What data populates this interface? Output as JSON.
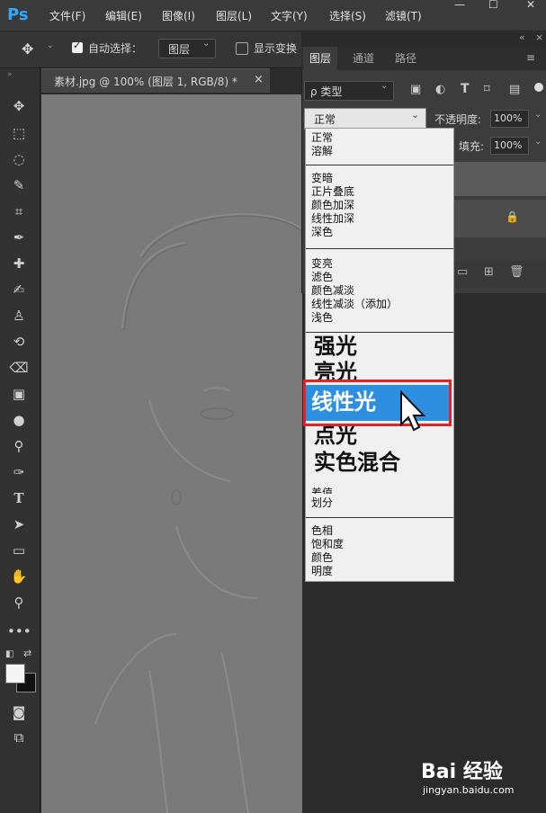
{
  "app": {
    "logo": "Ps",
    "menu": [
      "文件(F)",
      "编辑(E)",
      "图像(I)",
      "图层(L)",
      "文字(Y)",
      "选择(S)",
      "滤镜(T)"
    ]
  },
  "options_bar": {
    "auto_select_label": "自动选择：",
    "auto_select_target": "图层",
    "show_transform_label": "显示变换"
  },
  "document": {
    "tab_title": "素材.jpg @ 100% (图层 1, RGB/8) *",
    "close_glyph": "×"
  },
  "layers_panel": {
    "tabs": [
      "图层",
      "通道",
      "路径"
    ],
    "filter_kind": "ρ 类型",
    "blend_mode": "正常",
    "opacity_label": "不透明度:",
    "opacity_value": "100%",
    "fill_label": "填充:",
    "fill_value": "100%"
  },
  "blend_dropdown": {
    "group1": [
      "正常",
      "溶解"
    ],
    "group2": [
      "变暗",
      "正片叠底",
      "颜色加深",
      "线性加深",
      "深色"
    ],
    "group3": [
      "变亮",
      "滤色",
      "颜色减淡",
      "线性减淡（添加）",
      "浅色"
    ],
    "zoomed_items": [
      "强光",
      "亮光",
      "线性光",
      "点光",
      "实色混合"
    ],
    "highlighted": "线性光",
    "group4_tail": [
      "差值",
      "划分"
    ],
    "group5": [
      "色相",
      "饱和度",
      "颜色",
      "明度"
    ]
  },
  "watermark": {
    "brand": "Bai 经验",
    "url": "jingyan.baidu.com"
  },
  "colors": {
    "highlight": "#2e8fe0",
    "frame": "#e0242b",
    "ps_blue": "#31a8ff"
  }
}
